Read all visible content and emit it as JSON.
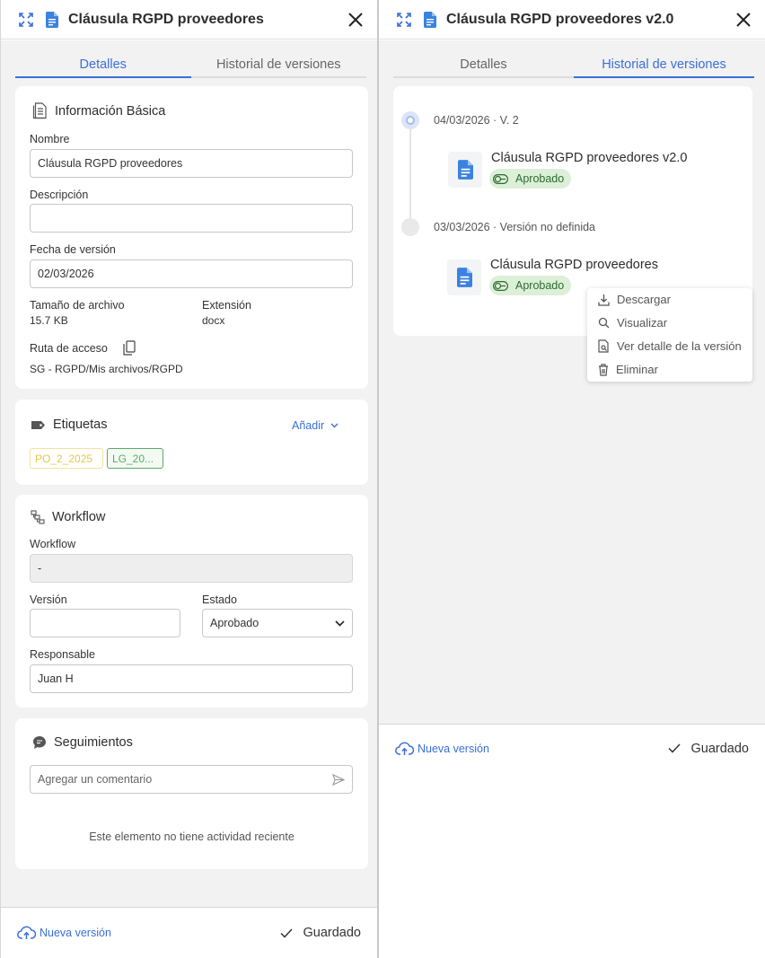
{
  "left": {
    "title": "Cláusula RGPD proveedores",
    "tabs": [
      "Detalles",
      "Historial de versiones"
    ],
    "basic": {
      "title": "Información Básica",
      "name_label": "Nombre",
      "name_value": "Cláusula RGPD proveedores",
      "description_label": "Descripción",
      "description_value": "",
      "version_date_label": "Fecha de versión",
      "version_date_value": "02/03/2026",
      "size_label": "Tamaño de archivo",
      "size_value": "15.7 KB",
      "extension_label": "Extensión",
      "extension_value": "docx",
      "path_label": "Ruta de acceso",
      "path_value": "SG - RGPD/Mis archivos/RGPD"
    },
    "tags": {
      "title": "Etiquetas",
      "add_label": "Añadir",
      "items": [
        {
          "label": "PO_2_2025",
          "color": "#e8c64a"
        },
        {
          "label": "LG_20...",
          "color": "#5daa6a"
        }
      ]
    },
    "workflow": {
      "title": "Workflow",
      "workflow_label": "Workflow",
      "workflow_value": "-",
      "version_label": "Versión",
      "version_value": "",
      "status_label": "Estado",
      "status_value": "Aprobado",
      "owner_label": "Responsable",
      "owner_value": "Juan H"
    },
    "followups": {
      "title": "Seguimientos",
      "comment_placeholder": "Agregar un comentario",
      "empty_text": "Este elemento no tiene actividad reciente"
    },
    "footer": {
      "new_version": "Nueva versión",
      "saved": "Guardado"
    }
  },
  "right": {
    "title": "Cláusula RGPD proveedores v2.0",
    "tabs": [
      "Detalles",
      "Historial de versiones"
    ],
    "versions": [
      {
        "date": "04/03/2026 · V. 2",
        "name": "Cláusula RGPD proveedores v2.0",
        "status": "Aprobado"
      },
      {
        "date": "03/03/2026 · Versión no definida",
        "name": "Cláusula RGPD proveedores",
        "status": "Aprobado"
      }
    ],
    "context_menu": [
      "Descargar",
      "Visualizar",
      "Ver detalle de la versión",
      "Eliminar"
    ],
    "footer": {
      "new_version": "Nueva versión",
      "saved": "Guardado"
    }
  },
  "colors": {
    "accent": "#3a6fd8",
    "approved_bg": "#dcefd7",
    "approved_text": "#2e6a34",
    "doc_blue": "#3b82e0"
  }
}
